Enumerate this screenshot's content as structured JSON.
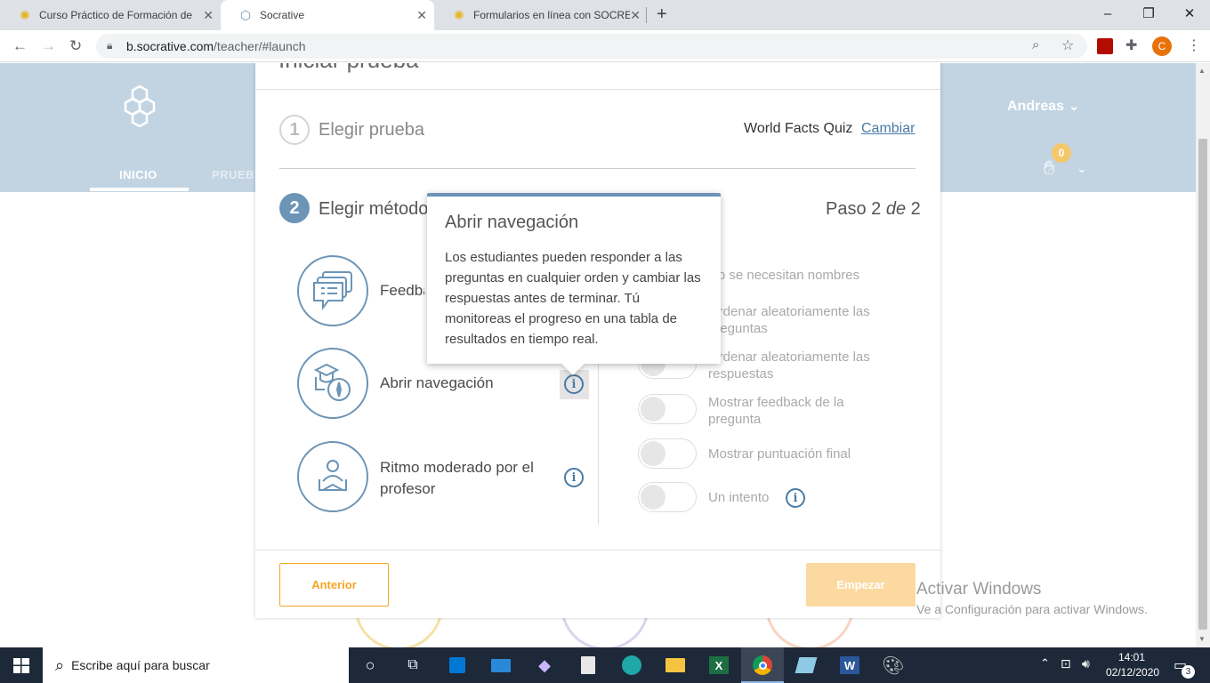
{
  "browser": {
    "tabs": [
      {
        "title": "Curso Práctico de Formación de ",
        "active": false
      },
      {
        "title": "Socrative",
        "active": true
      },
      {
        "title": "Formularios en línea con SOCRE",
        "active": false
      }
    ],
    "new_tab": "+",
    "url_host": "b.socrative.com",
    "url_path": "/teacher/#launch",
    "profile_initial": "C"
  },
  "header": {
    "nav_inicio": "INICIO",
    "nav_prueba": "PRUEB",
    "user": "Andreas",
    "badge": "0"
  },
  "modal": {
    "title": "Iniciar prueba",
    "step1_num": "1",
    "step1_title": "Elegir prueba",
    "quiz_name": "World Facts Quiz",
    "change": "Cambiar",
    "step2_num": "2",
    "step2_title": "Elegir método",
    "paso_a": "Paso 2 ",
    "paso_b": "de",
    "paso_c": " 2",
    "methods": [
      {
        "label": "Feedback instantáneo"
      },
      {
        "label": "Abrir navegación"
      },
      {
        "label": "Ritmo moderado por el profesor"
      }
    ],
    "options": [
      {
        "label": "No se necesitan nombres"
      },
      {
        "label": "Ordenar aleatoriamente las preguntas"
      },
      {
        "label": "Ordenar aleatoriamente las respuestas"
      },
      {
        "label": "Mostrar feedback de la pregunta"
      },
      {
        "label": "Mostrar puntuación final"
      },
      {
        "label": "Un intento"
      }
    ],
    "btn_prev": "Anterior",
    "btn_start": "Empezar"
  },
  "tooltip": {
    "title": "Abrir navegación",
    "body": "Los estudiantes pueden responder a las preguntas en cualquier orden y cambiar las respuestas antes de terminar. Tú monitoreas el progreso en una tabla de resultados en tiempo real."
  },
  "watermark": {
    "line1": "Activar Windows",
    "line2": "Ve a Configuración para activar Windows."
  },
  "taskbar": {
    "search_placeholder": "Escribe aquí para buscar",
    "time": "14:01",
    "date": "02/12/2020",
    "notifications": "3"
  },
  "colors": {
    "accent_blue": "#6b94b6",
    "header_bg": "#c2d4e2",
    "orange": "#f5a623",
    "start_disabled": "#fcd9a0"
  }
}
